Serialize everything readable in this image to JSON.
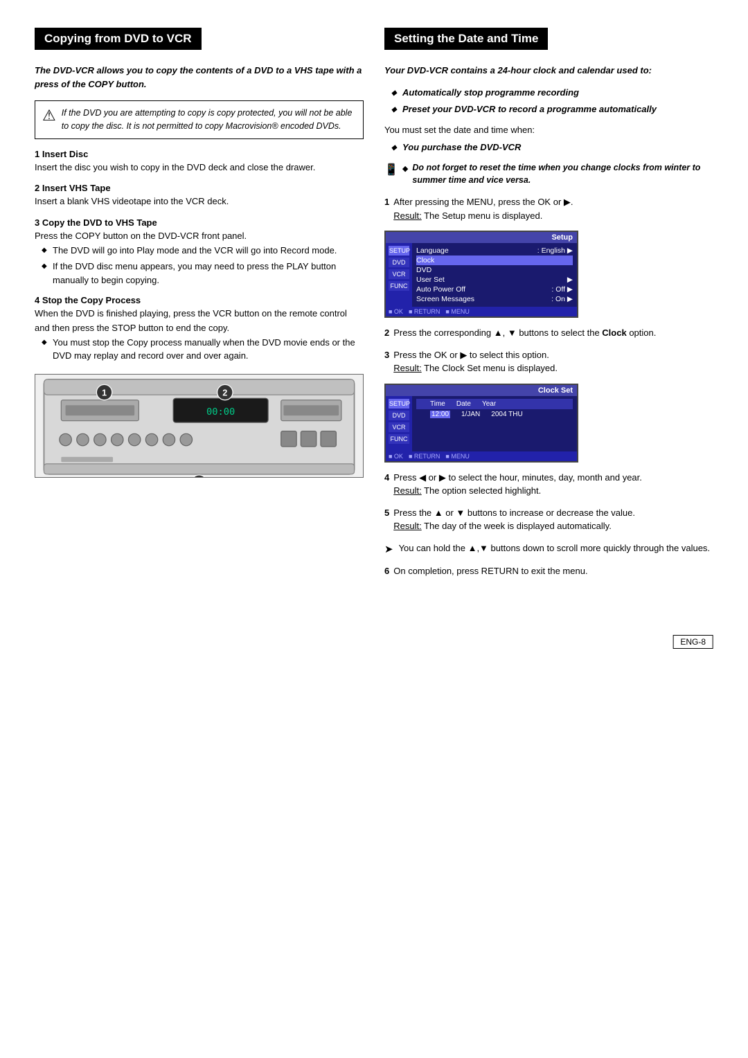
{
  "left_section": {
    "title": "Copying from DVD to VCR",
    "intro": "The DVD-VCR allows you to copy the contents of a DVD to a VHS tape with a press of the COPY button.",
    "warning": "If the DVD you are attempting to copy is copy protected, you will not be able to copy the disc. It is not permitted to copy Macrovision® encoded DVDs.",
    "steps": [
      {
        "number": "1",
        "title": "Insert Disc",
        "desc": "Insert the disc you wish to copy in the DVD deck and close the drawer."
      },
      {
        "number": "2",
        "title": "Insert VHS Tape",
        "desc": "Insert a blank VHS videotape into the VCR deck."
      },
      {
        "number": "3",
        "title": "Copy the DVD to VHS Tape",
        "desc": "Press the COPY button on the DVD-VCR front panel.",
        "bullets": [
          "The DVD will go into Play mode and the VCR will go into Record mode.",
          "If the DVD disc menu appears, you may need to press the PLAY button manually to begin copying."
        ]
      },
      {
        "number": "4",
        "title": "Stop the Copy Process",
        "desc": "When the DVD is finished playing, press the VCR button on the remote control and then press the STOP button to end the copy.",
        "bullets": [
          "You must stop the Copy process manually when the DVD movie ends or the DVD may replay and record over and over again."
        ]
      }
    ]
  },
  "right_section": {
    "title": "Setting the Date and Time",
    "intro": "Your DVD-VCR contains a 24-hour clock and calendar used to:",
    "bullets": [
      "Automatically stop programme recording",
      "Preset your DVD-VCR to record a programme automatically"
    ],
    "must_set": "You must set the date and time when:",
    "when_bullets": [
      "You purchase the DVD-VCR"
    ],
    "note": "Do not forget to reset the time when you change clocks from winter to summer time and vice versa.",
    "steps": [
      {
        "number": "1",
        "desc": "After pressing the MENU, press the OK or ▶.",
        "result_label": "Result:",
        "result": " The Setup menu is displayed."
      },
      {
        "number": "2",
        "desc": "Press the corresponding ▲, ▼ buttons to select the Clock option."
      },
      {
        "number": "3",
        "desc": "Press the OK or ▶ to select this option.",
        "result_label": "Result:",
        "result": " The Clock Set menu is displayed."
      },
      {
        "number": "4",
        "desc": "Press ◀ or ▶ to select the hour, minutes, day, month and year.",
        "result_label": "Result:",
        "result": " The option selected highlight."
      },
      {
        "number": "5",
        "desc": "Press the ▲ or ▼ buttons to increase or decrease the value.",
        "result_label": "Result:",
        "result": " The day of the week is displayed automatically."
      }
    ],
    "arrow_note": "You can hold the ▲,▼ buttons down to scroll more quickly through the values.",
    "step6": "On completion, press RETURN to exit the menu.",
    "menu": {
      "title": "Setup",
      "sidebar_items": [
        "SETUP",
        "DVD",
        "VCR",
        "FUNC"
      ],
      "rows": [
        {
          "label": "Language",
          "value": ": English",
          "highlighted": false
        },
        {
          "label": "Clock",
          "value": "",
          "highlighted": true
        },
        {
          "label": "DVD",
          "value": "",
          "highlighted": false
        },
        {
          "label": "User Set",
          "value": "",
          "highlighted": false
        },
        {
          "label": "Auto Power Off",
          "value": ": Off",
          "highlighted": false
        },
        {
          "label": "Screen Messages",
          "value": ": On",
          "highlighted": false
        }
      ],
      "footer": [
        "■ OK",
        "■ RETURN",
        "■ MENU"
      ]
    },
    "clock": {
      "title": "Clock Set",
      "headers": [
        "SETUP",
        "Time",
        "Date",
        "Year"
      ],
      "values": [
        "",
        "12:00",
        "1/JAN",
        "2004  THU"
      ],
      "sidebar_items": [
        "SETUP",
        "DVD",
        "VCR",
        "FUNC"
      ],
      "footer": [
        "■ OK",
        "■ RETURN",
        "■ MENU"
      ]
    }
  },
  "page_number": "ENG-8"
}
